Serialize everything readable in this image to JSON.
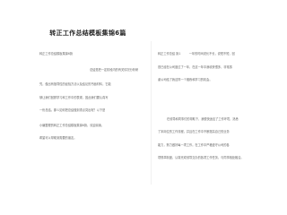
{
  "document": {
    "title": "转正工作总结模板集锦6篇",
    "left_column": {
      "heading": "转正工作总结模板集锦6篇",
      "lines": [
        "总结是把一定阶段内的有关情况分析研",
        "究，做出有指导性的经验方法以及结论的书面材料，它能",
        "够让我们回顾学习和工作中的表现，因此我们要认真写",
        "一份总结。那么如何把总结做到重点突出呢？以下是",
        "小编整理的转正工作总结模板集锦6篇，欢迎阅读，",
        "希望可以帮助到需要的朋友。"
      ]
    },
    "right_column": {
      "lines": [
        "转正工作总结 篇1  　 　 一年的时间说长不长，说短不短，回",
        "首已经在公司度过了一年，在这一年中我收获很多，非常感",
        "谢公司给了我这样一个锻炼和学习的机会。",
        "",
        "在领导和同事们的帮助下，我很快适应了工作环境，熟悉",
        "了本岗位的工作流程，并且在工作中不断提高自己的业务",
        "能力，努力做好每一项工作。在工作中严格遵守公司的各",
        "项规章制度，认真完成领导交办的各项工作任务，与同事相处融洽。"
      ]
    }
  }
}
